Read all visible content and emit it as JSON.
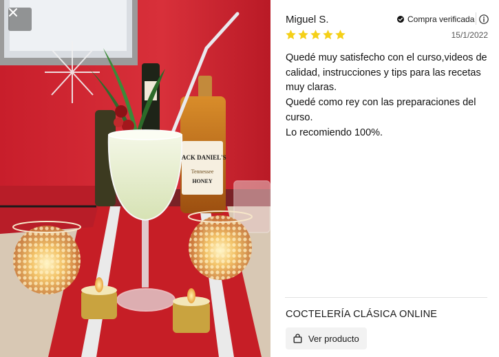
{
  "photo": {
    "alt": "Cóctel en copa con velas sobre mantel rojo",
    "bottle_label_brand": "JACK DANIEL'S",
    "bottle_label_sub": "Tennessee",
    "bottle_label_flavor": "HONEY"
  },
  "toolbar": {
    "close_icon": "close-icon"
  },
  "review": {
    "reviewer_name": "Miguel S.",
    "verified_label": "Compra verificada",
    "verified_icon": "check-circle-icon",
    "info_icon": "info-icon",
    "rating": 5,
    "rating_max": 5,
    "star_color": "#f5d018",
    "date": "15/1/2022",
    "body_lines": [
      "Quedé muy satisfecho con el curso,videos de calidad, instrucciones y tips para las recetas muy claras.",
      "Quedé como rey con las preparaciones del curso.",
      "Lo recomiendo 100%."
    ]
  },
  "product": {
    "title": "COCTELERÍA CLÁSICA ONLINE",
    "view_button_label": "Ver producto",
    "view_button_icon": "bag-icon"
  }
}
